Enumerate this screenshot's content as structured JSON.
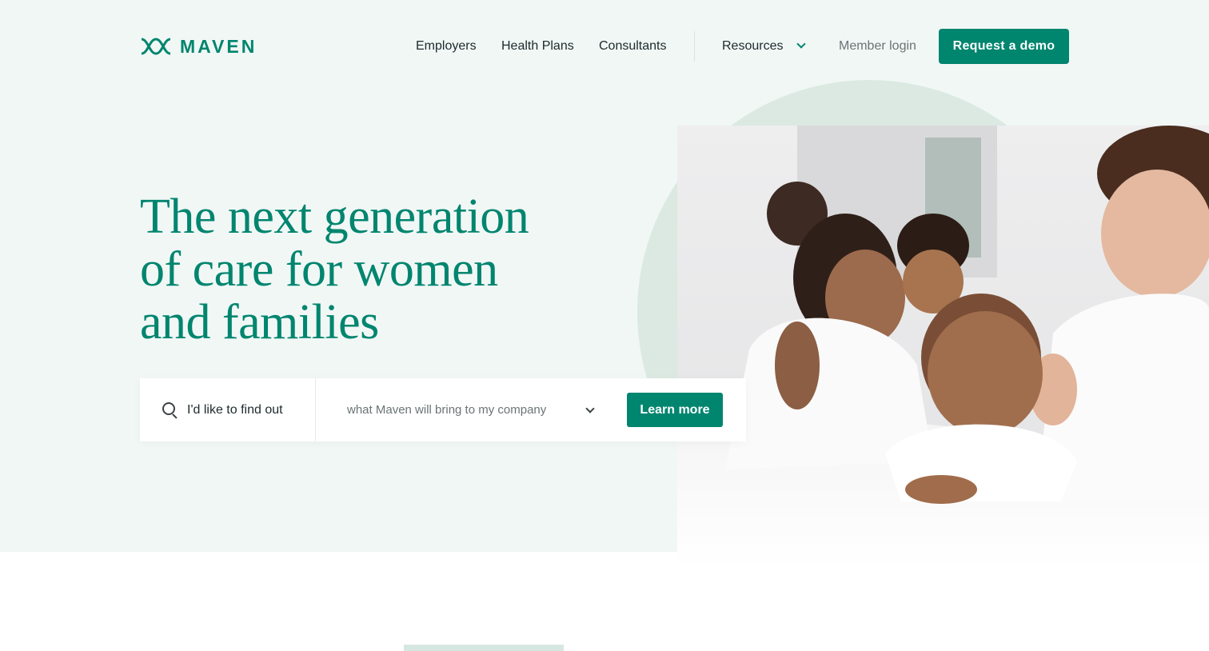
{
  "brand": {
    "name": "MAVEN",
    "color": "#00856f",
    "logo_icon": "maven-interlock-icon"
  },
  "nav": {
    "items": [
      {
        "label": "Employers"
      },
      {
        "label": "Health Plans"
      },
      {
        "label": "Consultants"
      },
      {
        "label": "Resources",
        "icon": "chevron-down-icon"
      },
      {
        "label": "Member login"
      }
    ],
    "cta_label": "Request a demo"
  },
  "hero": {
    "title_lines": [
      "The next generation",
      "of care for women",
      "and families"
    ],
    "image_description": "family-photo"
  },
  "search": {
    "icon": "search-icon",
    "label": "I'd like to find out",
    "selected_option": "what Maven will bring to my company",
    "button_label": "Learn more"
  },
  "colors": {
    "accent": "#00856f",
    "hero_background": "#f1f7f5",
    "circle": "#dbe9e2"
  }
}
